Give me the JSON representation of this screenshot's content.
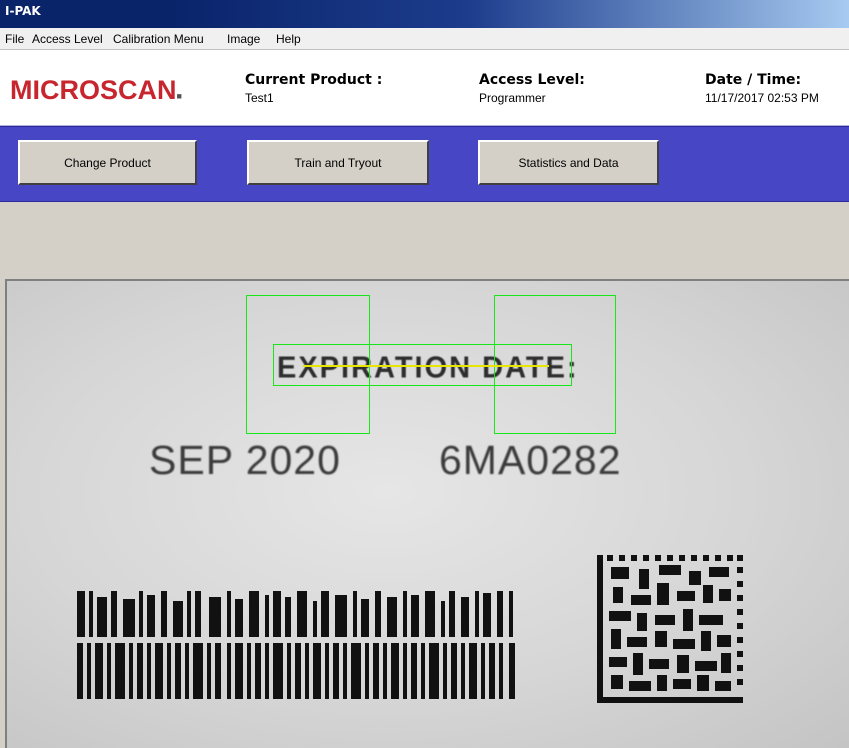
{
  "window": {
    "title": "I-PAK"
  },
  "menu": {
    "items": [
      "File",
      "Access Level",
      "Calibration Menu",
      "Image",
      "Help"
    ]
  },
  "header": {
    "logo_text": "MICROSCAN",
    "current_product_label": "Current Product :",
    "current_product_value": "Test1",
    "access_level_label": "Access Level:",
    "access_level_value": "Programmer",
    "datetime_label": "Date / Time:",
    "datetime_value": "11/17/2017 02:53 PM"
  },
  "toolbar": {
    "change_product": "Change Product",
    "train_tryout": "Train and Tryout",
    "statistics_data": "Statistics and Data"
  },
  "image": {
    "label_text": "EXPIRATION DATE:",
    "date_code": "SEP 2020",
    "lot_code": "6MA0282"
  },
  "colors": {
    "title_bar": "#0a246a",
    "logo_red": "#c8262e",
    "toolbar_blue": "#4747c6",
    "roi_green": "#19e619",
    "trace_yellow": "#e6e600"
  }
}
